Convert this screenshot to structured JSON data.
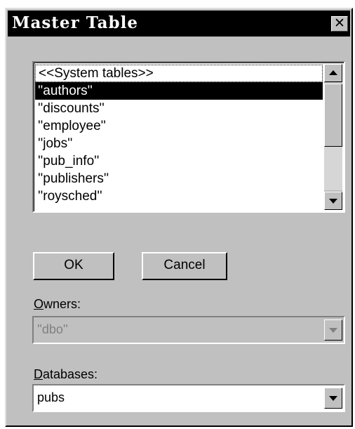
{
  "window": {
    "title": "Master Table",
    "close_glyph": "✕"
  },
  "tables_list": {
    "items": [
      "<<System tables>>",
      "''authors''",
      "''discounts''",
      "''employee''",
      "''jobs''",
      "''pub_info''",
      "''publishers''",
      "''roysched''"
    ],
    "selected_index": 1,
    "focused_index": 0
  },
  "buttons": {
    "ok_label": "OK",
    "cancel_label": "Cancel"
  },
  "owners": {
    "label_mnemonic": "O",
    "label_rest": "wners:",
    "value": "''dbo''",
    "enabled": false
  },
  "databases": {
    "label_mnemonic": "D",
    "label_rest": "atabases:",
    "value": "pubs",
    "enabled": true
  },
  "icons": {
    "close": "close-icon",
    "scroll_up": "arrow-up-icon",
    "scroll_down": "arrow-down-icon",
    "dropdown": "chevron-down-icon"
  },
  "colors": {
    "face": "#c0c0c0",
    "titlebar": "#000000",
    "selection": "#000000",
    "disabled_text": "#808080"
  }
}
